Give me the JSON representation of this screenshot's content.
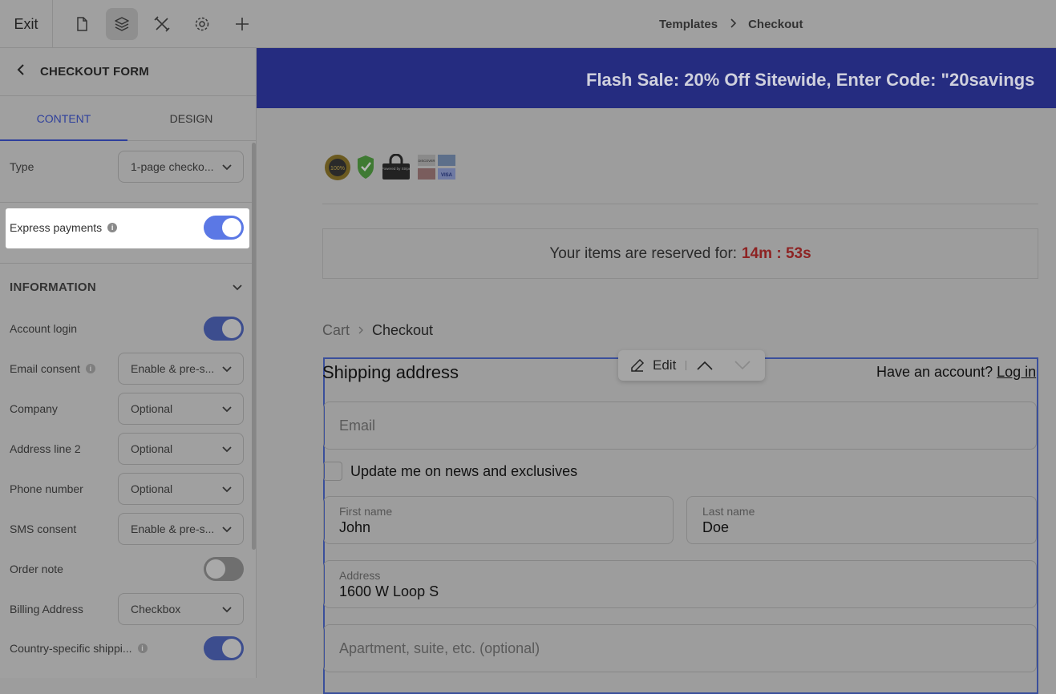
{
  "topbar": {
    "exit_label": "Exit",
    "tools": [
      "page-icon",
      "layers-icon",
      "tools-icon",
      "gear-icon",
      "plus-icon"
    ],
    "breadcrumb": [
      "Templates",
      "Checkout"
    ]
  },
  "sidebar": {
    "title": "CHECKOUT FORM",
    "tabs": [
      "CONTENT",
      "DESIGN"
    ],
    "type_label": "Type",
    "type_value": "1-page checko...",
    "express_label": "Express payments",
    "section_title": "INFORMATION",
    "rows": [
      {
        "label": "Account login",
        "control": "toggle",
        "state": "on"
      },
      {
        "label": "Email consent",
        "control": "select",
        "value": "Enable & pre-s...",
        "info": true
      },
      {
        "label": "Company",
        "control": "select",
        "value": "Optional"
      },
      {
        "label": "Address line 2",
        "control": "select",
        "value": "Optional"
      },
      {
        "label": "Phone number",
        "control": "select",
        "value": "Optional"
      },
      {
        "label": "SMS consent",
        "control": "select",
        "value": "Enable & pre-s..."
      },
      {
        "label": "Order note",
        "control": "toggle",
        "state": "off"
      },
      {
        "label": "Billing Address",
        "control": "select",
        "value": "Checkbox"
      },
      {
        "label": "Country-specific shippi...",
        "control": "toggle",
        "state": "on",
        "info": true
      }
    ]
  },
  "canvas": {
    "banner": "Flash Sale: 20% Off Sitewide, Enter Code: \"20savings",
    "badge_text": [
      "100%",
      "Powered by Stripe",
      "DISCOVER",
      "VISA"
    ],
    "timer_label": "Your items are reserved for:",
    "timer_value": "14m : 53s",
    "crumb": [
      "Cart",
      "Checkout"
    ],
    "shipping_title": "Shipping address",
    "account_text": "Have an account?",
    "login_link": "Log in",
    "edit_label": "Edit",
    "email_placeholder": "Email",
    "news_label": "Update me on news and exclusives",
    "first_name_label": "First name",
    "first_name_value": "John",
    "last_name_label": "Last name",
    "last_name_value": "Doe",
    "address_label": "Address",
    "address_value": "1600 W Loop S",
    "apartment_placeholder": "Apartment, suite, etc. (optional)"
  },
  "colors": {
    "accent": "#2e3f9c",
    "banner": "#252c80",
    "timer": "#8d2323",
    "toggle_highlight": "#5b78e5"
  }
}
